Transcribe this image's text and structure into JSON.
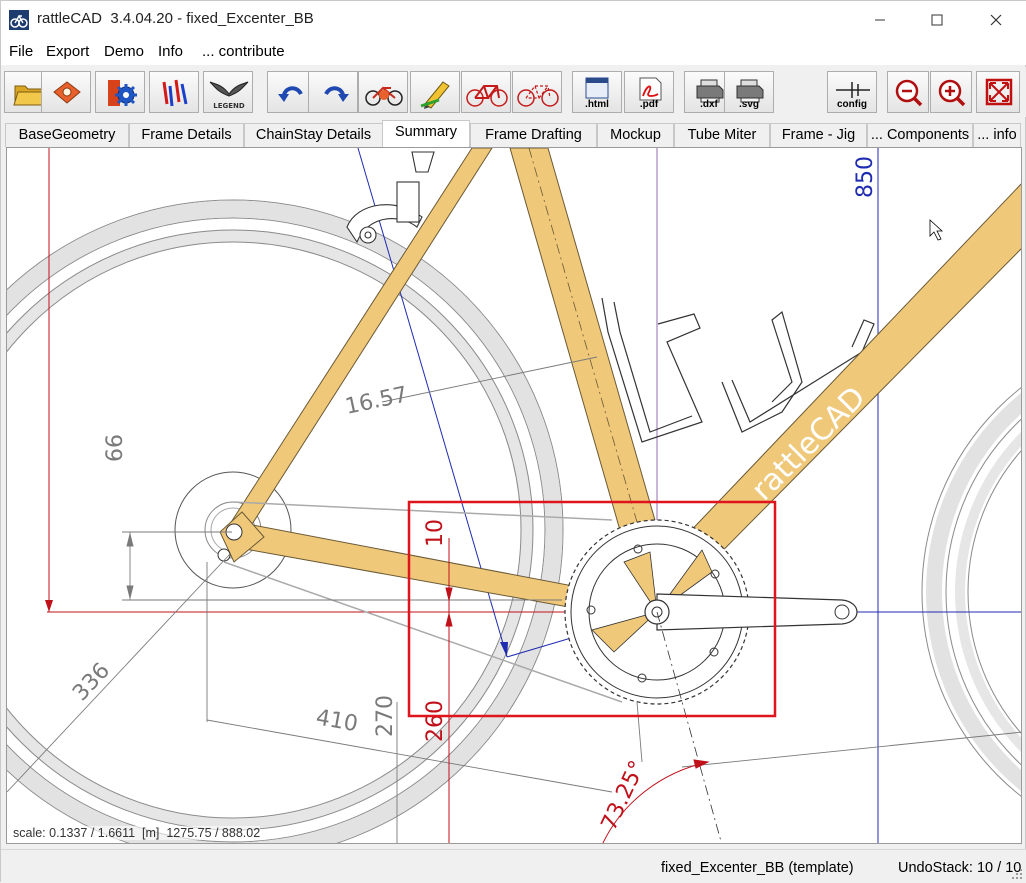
{
  "window": {
    "title": "rattleCAD  3.4.04.20 - fixed_Excenter_BB",
    "minimize_glyph": "—",
    "maximize_glyph": "☐",
    "close_glyph": "✕"
  },
  "menu": {
    "file": "File",
    "export": "Export",
    "demo": "Demo",
    "info": "Info",
    "contribute": "... contribute"
  },
  "toolbar": {
    "buttons": [
      {
        "icon": "open-folder-icon"
      },
      {
        "icon": "save-disk-icon"
      },
      {
        "icon": "settings-gear-icon"
      },
      {
        "icon": "tube-parts-icon"
      },
      {
        "icon": "legend-wings-icon",
        "label": "LEGEND"
      },
      {
        "icon": "undo-icon"
      },
      {
        "icon": "redo-icon"
      },
      {
        "icon": "bike-rider-icon"
      },
      {
        "icon": "pencil-icon"
      },
      {
        "icon": "bike-frame-icon"
      },
      {
        "icon": "bike-frame-alt-icon"
      },
      {
        "icon": "export-html-icon",
        "label": ".html"
      },
      {
        "icon": "export-pdf-icon",
        "label": ".pdf"
      },
      {
        "icon": "export-dxf-icon",
        "label": ".dxf"
      },
      {
        "icon": "export-svg-icon",
        "label": ".svg"
      },
      {
        "icon": "config-icon",
        "label": "config"
      },
      {
        "icon": "zoom-out-icon"
      },
      {
        "icon": "zoom-in-icon"
      },
      {
        "icon": "fit-to-window-icon"
      }
    ]
  },
  "tabs": [
    {
      "label": "BaseGeometry",
      "active": false
    },
    {
      "label": "Frame Details",
      "active": false
    },
    {
      "label": "ChainStay Details",
      "active": false
    },
    {
      "label": "Summary",
      "active": true
    },
    {
      "label": "Frame Drafting",
      "active": false
    },
    {
      "label": "Mockup",
      "active": false
    },
    {
      "label": "Tube Miter",
      "active": false
    },
    {
      "label": "Frame - Jig",
      "active": false
    },
    {
      "label": "... Components",
      "active": false
    },
    {
      "label": "... info",
      "active": false
    }
  ],
  "drawing": {
    "dimensions": {
      "d850": "850",
      "d1657": "16.57",
      "d66": "66",
      "d10": "10",
      "d336": "336",
      "d410": "410",
      "d270": "270",
      "d260": "260",
      "angle": "73.25°"
    },
    "downtube_logo": "rattleCAD",
    "colors": {
      "tube_fill": "#efc87a",
      "tube_stroke": "#6b5a36",
      "wheel_gray": "#d9d9d9",
      "dim_gray": "#7a7a7a",
      "red": "#c0101a",
      "blue": "#1f2bb0",
      "highlight_red": "#e0141c"
    }
  },
  "scale_readout": "scale: 0.1337 / 1.6611  [m]  1275.75 / 888.02",
  "status": {
    "file": "fixed_Excenter_BB (template)",
    "undo": "UndoStack: 10 / 10"
  }
}
